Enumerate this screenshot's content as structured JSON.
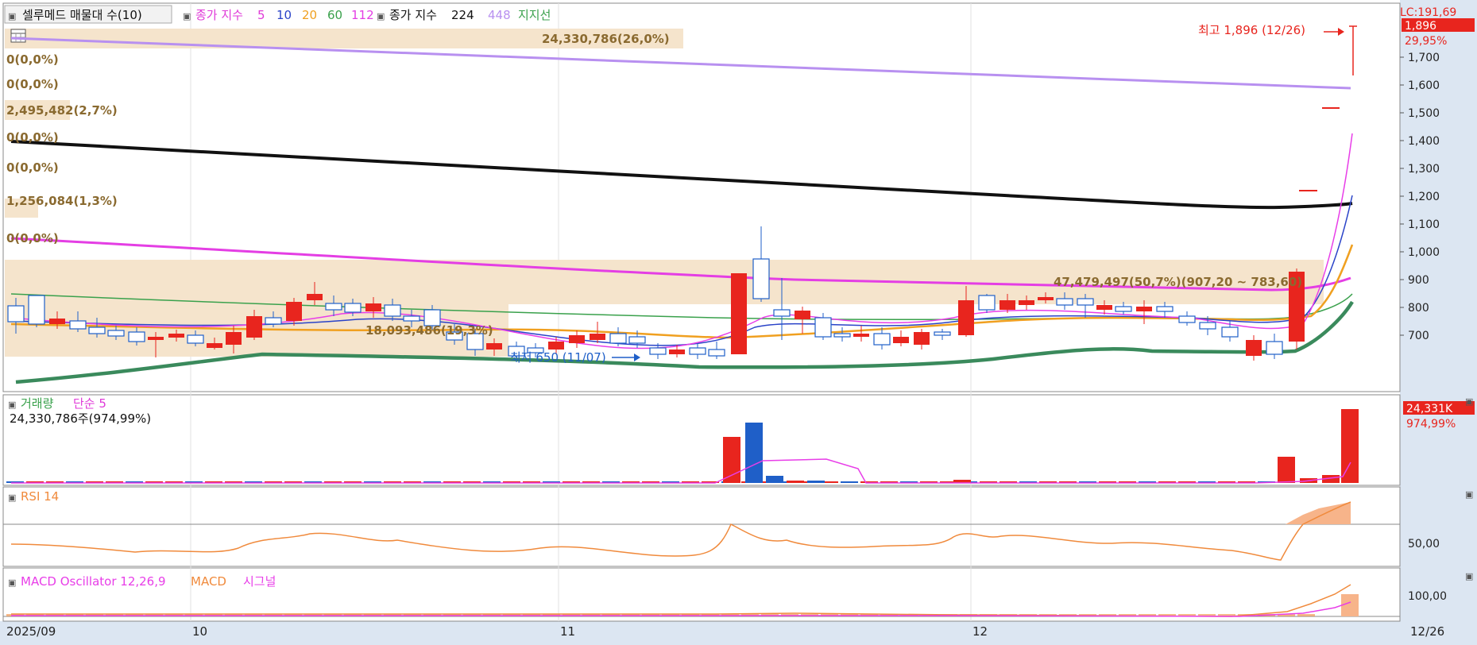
{
  "legend": {
    "main": {
      "title": "셀루메드 매물대 수(10)",
      "ma_label": "종가 지수",
      "ma_periods": [
        "5",
        "10",
        "20",
        "60",
        "112"
      ],
      "ma2_label": "종가 지수",
      "ma2_periods": [
        "224",
        "448"
      ],
      "support_label": "지지선"
    },
    "volume": {
      "label": "거래량",
      "ma_label": "단순 5",
      "summary": "24,330,786주(974,99%)"
    },
    "rsi": {
      "label": "RSI 14"
    },
    "macd": {
      "label": "MACD Oscillator 12,26,9",
      "macd": "MACD",
      "signal": "시그널"
    }
  },
  "price_panel": {
    "lc_text": "LC:191,69",
    "current_price": "1,896",
    "change_pct": "29,95%",
    "y_ticks": [
      "1,700",
      "1,600",
      "1,500",
      "1,400",
      "1,300",
      "1,200",
      "1,100",
      "1,000",
      "900",
      "800",
      "700"
    ],
    "high_label": "최고 1,896 (12/26)",
    "low_label": "최저 650 (11/07)",
    "profile_labels": [
      "24,330,786(26,0%)",
      "0(0,0%)",
      "0(0,0%)",
      "2,495,482(2,7%)",
      "0(0,0%)",
      "0(0,0%)",
      "1,256,084(1,3%)",
      "0(0,0%)",
      "47,479,497(50,7%)(907,20 ~ 783,60)",
      "18,093,486(19,3%)"
    ]
  },
  "volume_panel": {
    "last_value": "24,331K",
    "last_pct": "974,99%"
  },
  "rsi_panel": {
    "tick": "50,00"
  },
  "macd_panel": {
    "tick": "100,00"
  },
  "x_axis": {
    "labels": [
      "2025/09",
      "10",
      "11",
      "12"
    ],
    "last_date": "12/26"
  },
  "colors": {
    "up": "#e8251e",
    "down": "#1f5fc8",
    "ma5": "#e83ee8",
    "ma10": "#2a43c8",
    "ma20": "#f0a020",
    "ma60": "#3aa14c",
    "ma112": "#e43ee4",
    "ma224": "#111111",
    "ma448": "#b890f0",
    "support": "#3a9a6a",
    "profile": "#f5e4cc",
    "rsi": "#f08a3c",
    "axis_bg": "#dce6f2"
  },
  "chart_data": [
    {
      "type": "candlestick",
      "title": "셀루메드 매물대 수(10)",
      "x_range": [
        "2025/09",
        "12/26"
      ],
      "ylim": [
        600,
        1900
      ],
      "series_ma": [
        {
          "name": "224",
          "start": 1310,
          "end": 1070
        },
        {
          "name": "448",
          "start": 1880,
          "end": 1550
        },
        {
          "name": "112",
          "start": 960,
          "end": 845
        }
      ],
      "high": {
        "value": 1896,
        "date": "12/26"
      },
      "low": {
        "value": 650,
        "date": "11/07"
      },
      "last_close": 1896,
      "volume_profile": [
        {
          "label": "24,330,786(26,0%)",
          "volume": 24330786,
          "pct": 26.0,
          "low": 1800,
          "high": 1900
        },
        {
          "label": "2,495,482(2,7%)",
          "volume": 2495482,
          "pct": 2.7,
          "low": 1500,
          "high": 1560
        },
        {
          "label": "1,256,084(1,3%)",
          "volume": 1256084,
          "pct": 1.3,
          "low": 1040,
          "high": 1110
        },
        {
          "label": "47,479,497(50,7%)(907,20 ~ 783,60)",
          "volume": 47479497,
          "pct": 50.7,
          "low": 783.6,
          "high": 907.2
        },
        {
          "label": "18,093,486(19,3%)",
          "volume": 18093486,
          "pct": 19.3,
          "low": 660,
          "high": 783.6
        }
      ]
    },
    {
      "type": "bar",
      "title": "거래량",
      "last_volume": "24,331K",
      "last_pct": "974,99%"
    },
    {
      "type": "line",
      "title": "RSI 14",
      "y_tick": "50,00"
    },
    {
      "type": "line",
      "title": "MACD Oscillator 12,26,9",
      "y_tick": "100,00"
    }
  ]
}
